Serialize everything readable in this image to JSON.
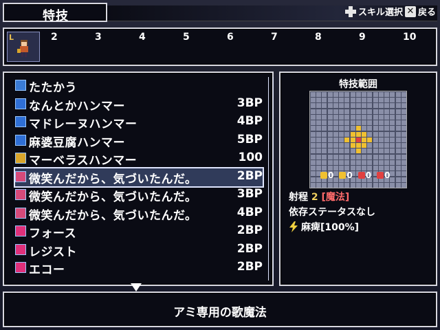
{
  "header": {
    "title": "特技",
    "hints": [
      {
        "icon": "dpad-icon",
        "label": "スキル選択"
      },
      {
        "icon": "cancel-button-icon",
        "label": "戻る"
      }
    ]
  },
  "level_bar": {
    "char_badge": "L",
    "levels": [
      "2",
      "3",
      "4",
      "5",
      "6",
      "7",
      "8",
      "9",
      "10"
    ]
  },
  "skills": [
    {
      "name": "たたかう",
      "cost": "",
      "icon": "attack-icon",
      "icon_color": "#3a7bd5"
    },
    {
      "name": "なんとかハンマー",
      "cost": "3BP",
      "icon": "hammer-skill-icon",
      "icon_color": "#2f6fd6"
    },
    {
      "name": "マドレーヌハンマー",
      "cost": "4BP",
      "icon": "hammer-skill-icon",
      "icon_color": "#2f6fd6"
    },
    {
      "name": "麻婆豆腐ハンマー",
      "cost": "5BP",
      "icon": "hammer-skill-icon",
      "icon_color": "#2f6fd6"
    },
    {
      "name": "マーベラスハンマー",
      "cost": "100",
      "icon": "special-skill-icon",
      "icon_color": "#d9a52b"
    },
    {
      "name": "微笑んだから、気づいたんだ。",
      "cost": "2BP",
      "icon": "song-icon",
      "icon_color": "#d64a7a"
    },
    {
      "name": "微笑んだから、気づいたんだ。",
      "cost": "3BP",
      "icon": "song-plus1-icon",
      "icon_color": "#d64a7a"
    },
    {
      "name": "微笑んだから、気づいたんだ。",
      "cost": "4BP",
      "icon": "song-plus2-icon",
      "icon_color": "#d64a7a"
    },
    {
      "name": "フォース",
      "cost": "2BP",
      "icon": "vo-magic-icon",
      "icon_color": "#e0307a"
    },
    {
      "name": "レジスト",
      "cost": "2BP",
      "icon": "vo-magic-icon",
      "icon_color": "#e0307a"
    },
    {
      "name": "エコー",
      "cost": "2BP",
      "icon": "vo-magic-icon",
      "icon_color": "#e0307a"
    }
  ],
  "selected_index": 5,
  "range_panel": {
    "title": "特技範囲",
    "resists": [
      {
        "icon": "yellow-resist-icon",
        "color": "#f0c030",
        "value": "0"
      },
      {
        "icon": "yellow-resist-icon",
        "color": "#f0c030",
        "value": "0"
      },
      {
        "icon": "red-resist-icon",
        "color": "#e04040",
        "value": "0"
      },
      {
        "icon": "red-resist-icon",
        "color": "#e04040",
        "value": "0"
      }
    ],
    "range_label": "射程",
    "range_value": "2",
    "range_type": "[魔法]",
    "dependency": "依存ステータスなし",
    "effect": "麻痺[100%]"
  },
  "description": "アミ専用の歌魔法",
  "colors": {
    "range_value": "#f0d060",
    "range_type": "#ff6b6b",
    "grid_highlight": "#f0c030",
    "grid_center": "#e04040"
  }
}
